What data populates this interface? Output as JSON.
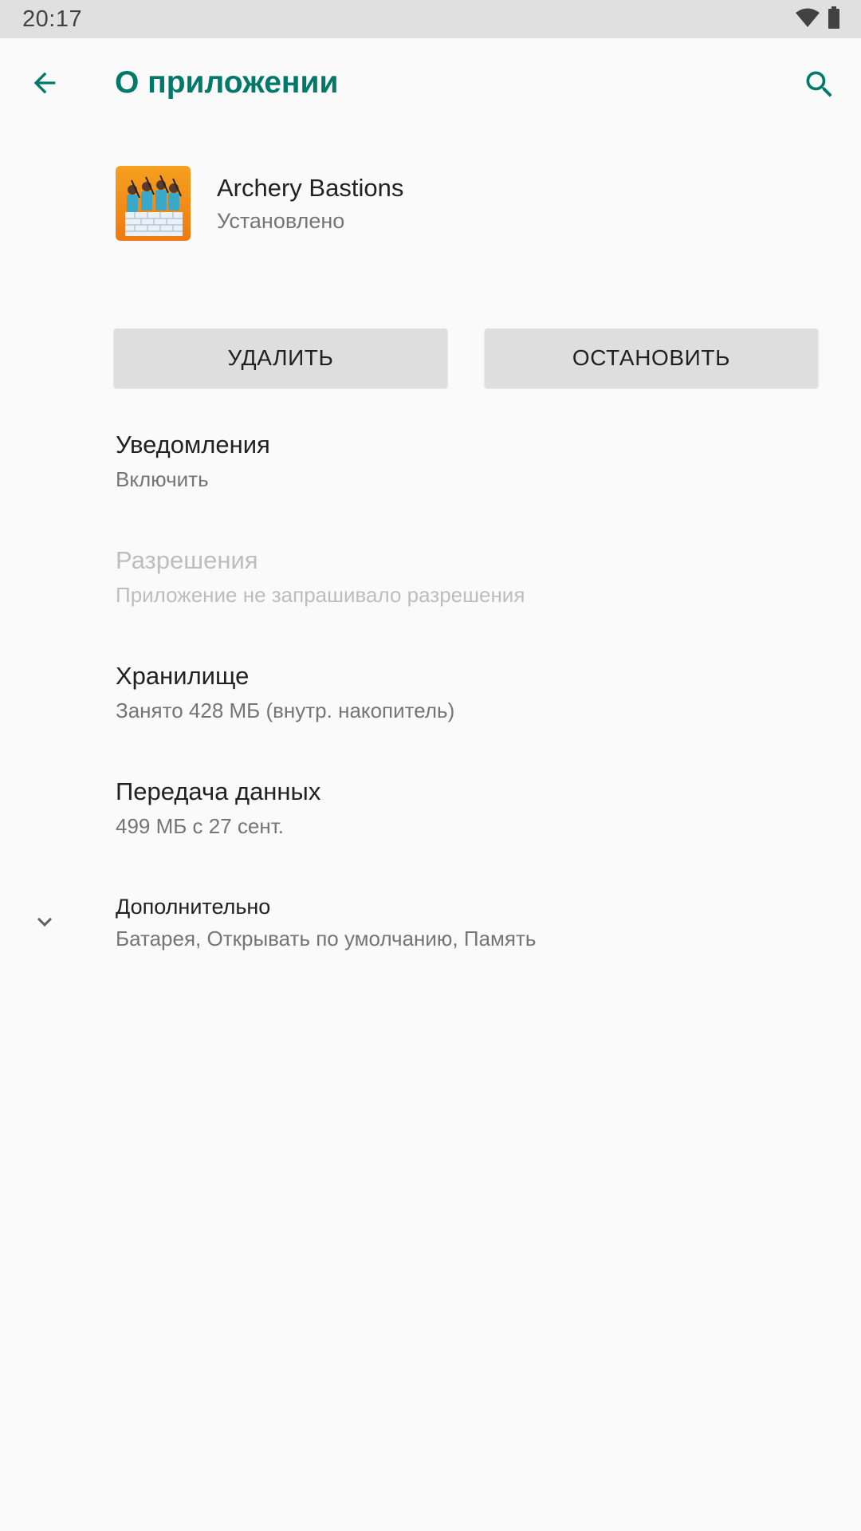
{
  "status_bar": {
    "time": "20:17",
    "wifi_icon": "wifi-icon",
    "battery_icon": "battery-icon"
  },
  "app_bar": {
    "title": "О приложении",
    "back_icon": "arrow-back-icon",
    "search_icon": "search-icon",
    "accent_color": "#00796b"
  },
  "app": {
    "name": "Archery Bastions",
    "status": "Установлено",
    "icon": "app-icon"
  },
  "actions": {
    "uninstall_label": "УДАЛИТЬ",
    "stop_label": "ОСТАНОВИТЬ"
  },
  "settings": {
    "notifications": {
      "title": "Уведомления",
      "subtitle": "Включить"
    },
    "permissions": {
      "title": "Разрешения",
      "subtitle": "Приложение не запрашивало разрешения",
      "enabled": false
    },
    "storage": {
      "title": "Хранилище",
      "subtitle": "Занято 428 МБ (внутр. накопитель)"
    },
    "data_usage": {
      "title": "Передача данных",
      "subtitle": "499 МБ с 27 сент."
    },
    "advanced": {
      "title": "Дополнительно",
      "subtitle": "Батарея, Открывать по умолчанию, Память",
      "icon": "chevron-down-icon"
    }
  }
}
